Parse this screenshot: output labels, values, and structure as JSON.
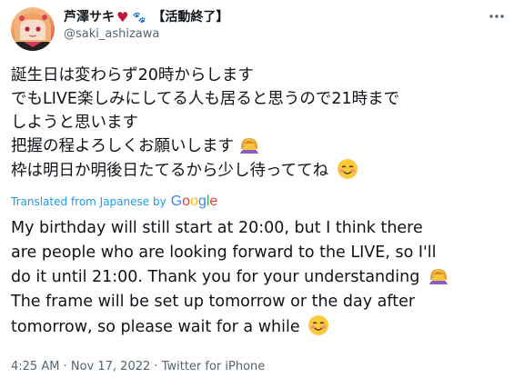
{
  "author": {
    "name": "芦澤サキ",
    "heart": "♥",
    "paws": "🐾",
    "status": "【活動終了】",
    "handle": "@saki_ashizawa",
    "avatar_icon": "profile-avatar"
  },
  "tweet": {
    "jp_lines": [
      "誕生日は変わらず20時からします",
      "でもLIVE楽しみにしてる人も居ると思うので21時まで",
      "しようと思います",
      "把握の程よろしくお願いします",
      "枠は明日か明後日たてるから少し待っててね"
    ],
    "translated_label": "Translated from Japanese by",
    "translator": {
      "letters": [
        "G",
        "o",
        "o",
        "g",
        "l",
        "e"
      ],
      "colors": [
        "#4285F4",
        "#EA4335",
        "#FBBC05",
        "#4285F4",
        "#34A853",
        "#EA4335"
      ]
    },
    "en_lines": [
      "My birthday will still start at 20:00, but I think there",
      "are people who are looking forward to the LIVE, so I'll",
      "do it until 21:00. Thank you for your understanding",
      "The frame will be set up tomorrow or the day after",
      "tomorrow, so please wait for a while"
    ],
    "emojis": {
      "bowing": "person-bowing-emoji",
      "smiling": "smiling-face-emoji"
    }
  },
  "meta": {
    "time": "4:25 AM",
    "separator": "·",
    "date": "Nov 17, 2022",
    "source": "Twitter for iPhone"
  }
}
